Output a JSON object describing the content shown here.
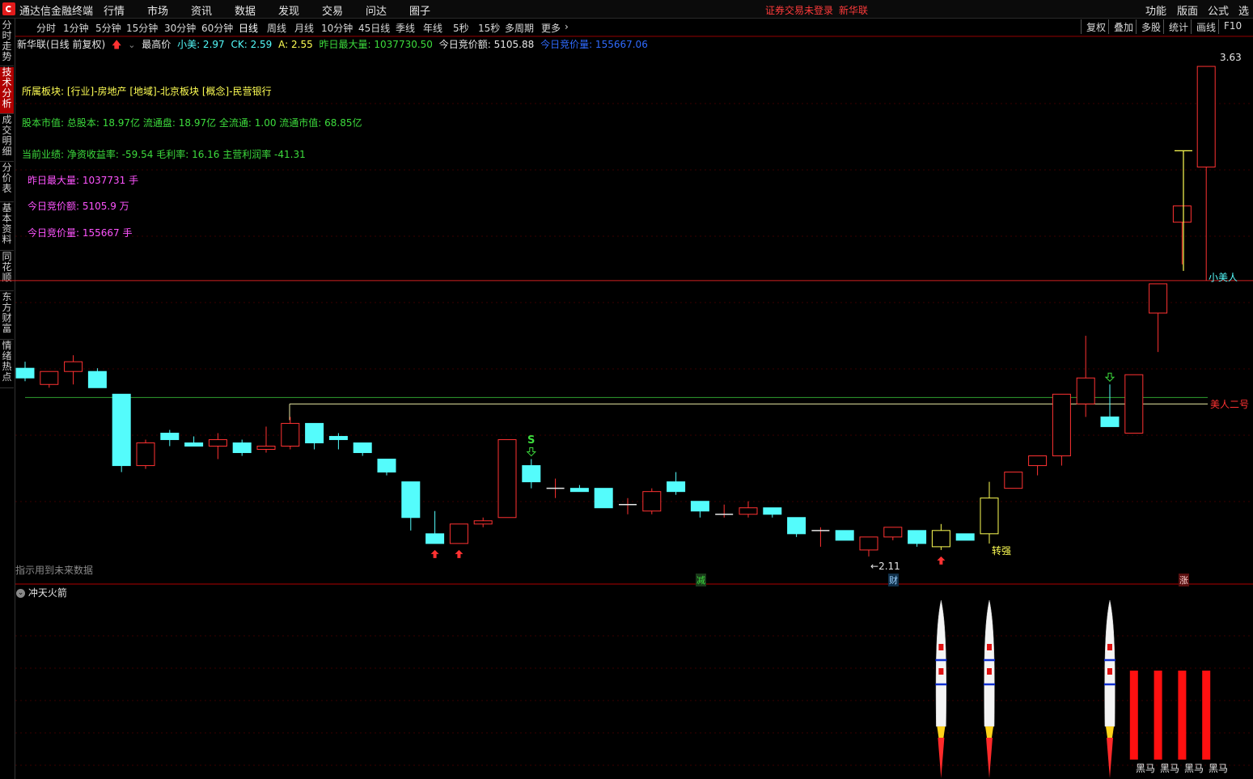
{
  "menubar": {
    "app_title": "通达信金融终端",
    "menus": [
      "行情",
      "市场",
      "资讯",
      "数据",
      "发现",
      "交易",
      "问达",
      "圈子"
    ],
    "status_warning": "证券交易未登录",
    "stock_name": "新华联",
    "right_menus": [
      "功能",
      "版面",
      "公式",
      "选项"
    ]
  },
  "periodbar": {
    "periods": [
      "分时",
      "1分钟",
      "5分钟",
      "15分钟",
      "30分钟",
      "60分钟",
      "日线",
      "周线",
      "月线",
      "10分钟",
      "45日线",
      "季线",
      "年线",
      "5秒",
      "15秒",
      "多周期",
      "更多"
    ],
    "active": "日线",
    "tools": [
      "复权",
      "叠加",
      "多股",
      "统计",
      "画线",
      "F10"
    ]
  },
  "lefttabs": [
    "分时走势",
    "技术分析",
    "成交明细",
    "分价表",
    "基本资料",
    "同花顺",
    "东方财富",
    "情绪热点"
  ],
  "lefttabs_active": "技术分析",
  "infoline": {
    "title": "新华联(日线 前复权)",
    "indicator": "最高价",
    "xm_label": "小美: 2.97",
    "ck_label": "CK: 2.59",
    "a_label": "A: 2.55",
    "max_vol_label": "昨日最大量: 1037730.50",
    "amount_label": "今日竞价额: 5105.88",
    "auction_vol_label": "今日竞价量: 155667.06"
  },
  "info_block": {
    "sector": "所属板块: [行业]-房地产 [地域]-北京板块 [概念]-民营银行",
    "capital": "股本市值: 总股本: 18.97亿 流通盘: 18.97亿 全流通: 1.00 流通市值: 68.85亿",
    "performance": "当前业绩: 净资收益率: -59.54 毛利率: 16.16 主营利润率 -41.31",
    "yday_max_vol": "昨日最大量: 1037731  手",
    "today_amount": "今日竞价额: 5105.9  万",
    "today_vol": "今日竞价量: 155667  手"
  },
  "annotations": {
    "high_value": "3.63",
    "low_value": "2.11",
    "line_xiaomeiren": "小美人",
    "line_meiren2": "美人二号",
    "signal_s": "S",
    "signal_zhuanqiang": "转强",
    "tag_jian": "减",
    "tag_cai": "财",
    "tag_zhang": "涨",
    "future_note": "指示用到未来数据"
  },
  "lower_pane": {
    "title": "冲天火箭",
    "heima_label": "黑马"
  },
  "colors": {
    "up": "#ff3232",
    "down": "#54fcfc",
    "warn": "#ff3b3b",
    "green_text": "#3ddc3d",
    "yellow_text": "#ffff54",
    "magenta_text": "#ff54ff",
    "blue_text": "#2f6bff"
  },
  "chart_data": {
    "type": "candlestick",
    "price_range": [
      2.05,
      3.68
    ],
    "candles": [
      {
        "o": 2.7,
        "h": 2.72,
        "l": 2.66,
        "c": 2.67
      },
      {
        "o": 2.65,
        "h": 2.69,
        "l": 2.64,
        "c": 2.69
      },
      {
        "o": 2.69,
        "h": 2.74,
        "l": 2.65,
        "c": 2.72
      },
      {
        "o": 2.69,
        "h": 2.7,
        "l": 2.64,
        "c": 2.64
      },
      {
        "o": 2.62,
        "h": 2.62,
        "l": 2.38,
        "c": 2.4
      },
      {
        "o": 2.4,
        "h": 2.48,
        "l": 2.39,
        "c": 2.47
      },
      {
        "o": 2.5,
        "h": 2.51,
        "l": 2.46,
        "c": 2.48
      },
      {
        "o": 2.47,
        "h": 2.49,
        "l": 2.46,
        "c": 2.46
      },
      {
        "o": 2.46,
        "h": 2.5,
        "l": 2.42,
        "c": 2.48
      },
      {
        "o": 2.47,
        "h": 2.48,
        "l": 2.43,
        "c": 2.44
      },
      {
        "o": 2.45,
        "h": 2.52,
        "l": 2.44,
        "c": 2.46
      },
      {
        "o": 2.46,
        "h": 2.55,
        "l": 2.45,
        "c": 2.53
      },
      {
        "o": 2.53,
        "h": 2.53,
        "l": 2.45,
        "c": 2.47
      },
      {
        "o": 2.49,
        "h": 2.5,
        "l": 2.45,
        "c": 2.48
      },
      {
        "o": 2.47,
        "h": 2.47,
        "l": 2.43,
        "c": 2.44
      },
      {
        "o": 2.42,
        "h": 2.42,
        "l": 2.37,
        "c": 2.38
      },
      {
        "o": 2.35,
        "h": 2.35,
        "l": 2.2,
        "c": 2.24
      },
      {
        "o": 2.19,
        "h": 2.26,
        "l": 2.16,
        "c": 2.16
      },
      {
        "o": 2.16,
        "h": 2.22,
        "l": 2.16,
        "c": 2.22
      },
      {
        "o": 2.22,
        "h": 2.24,
        "l": 2.21,
        "c": 2.23
      },
      {
        "o": 2.24,
        "h": 2.48,
        "l": 2.24,
        "c": 2.48
      },
      {
        "o": 2.4,
        "h": 2.42,
        "l": 2.33,
        "c": 2.35
      },
      {
        "o": 2.33,
        "h": 2.36,
        "l": 2.3,
        "c": 2.33
      },
      {
        "o": 2.33,
        "h": 2.34,
        "l": 2.32,
        "c": 2.32
      },
      {
        "o": 2.33,
        "h": 2.33,
        "l": 2.27,
        "c": 2.27
      },
      {
        "o": 2.28,
        "h": 2.3,
        "l": 2.25,
        "c": 2.28
      },
      {
        "o": 2.26,
        "h": 2.33,
        "l": 2.25,
        "c": 2.32
      },
      {
        "o": 2.35,
        "h": 2.38,
        "l": 2.31,
        "c": 2.32
      },
      {
        "o": 2.29,
        "h": 2.29,
        "l": 2.24,
        "c": 2.26
      },
      {
        "o": 2.25,
        "h": 2.28,
        "l": 2.24,
        "c": 2.25
      },
      {
        "o": 2.25,
        "h": 2.29,
        "l": 2.24,
        "c": 2.27
      },
      {
        "o": 2.27,
        "h": 2.27,
        "l": 2.24,
        "c": 2.25
      },
      {
        "o": 2.24,
        "h": 2.24,
        "l": 2.18,
        "c": 2.19
      },
      {
        "o": 2.2,
        "h": 2.21,
        "l": 2.15,
        "c": 2.2
      },
      {
        "o": 2.2,
        "h": 2.2,
        "l": 2.17,
        "c": 2.17
      },
      {
        "o": 2.14,
        "h": 2.18,
        "l": 2.12,
        "c": 2.18
      },
      {
        "o": 2.18,
        "h": 2.21,
        "l": 2.17,
        "c": 2.21
      },
      {
        "o": 2.2,
        "h": 2.2,
        "l": 2.15,
        "c": 2.16
      },
      {
        "o": 2.15,
        "h": 2.22,
        "l": 2.14,
        "c": 2.2
      },
      {
        "o": 2.19,
        "h": 2.19,
        "l": 2.17,
        "c": 2.17
      },
      {
        "o": 2.19,
        "h": 2.35,
        "l": 2.16,
        "c": 2.3
      },
      {
        "o": 2.33,
        "h": 2.38,
        "l": 2.33,
        "c": 2.38
      },
      {
        "o": 2.4,
        "h": 2.43,
        "l": 2.37,
        "c": 2.43
      },
      {
        "o": 2.43,
        "h": 2.62,
        "l": 2.4,
        "c": 2.62
      },
      {
        "o": 2.59,
        "h": 2.8,
        "l": 2.55,
        "c": 2.67
      },
      {
        "o": 2.55,
        "h": 2.65,
        "l": 2.53,
        "c": 2.52
      },
      {
        "o": 2.5,
        "h": 2.68,
        "l": 2.5,
        "c": 2.68
      },
      {
        "o": 2.87,
        "h": 2.87,
        "l": 2.75,
        "c": 2.96
      },
      {
        "o": 3.15,
        "h": 3.2,
        "l": 3.02,
        "c": 3.2
      },
      {
        "o": 3.32,
        "h": 3.63,
        "l": 2.97,
        "c": 3.63
      }
    ],
    "rocket_signal_indices": [
      38,
      40,
      45
    ],
    "heima_indices": [
      46,
      47,
      48,
      49
    ],
    "xiaomeiren_level": 2.97,
    "meiren2_level": 2.61,
    "ck_level": 2.59
  }
}
